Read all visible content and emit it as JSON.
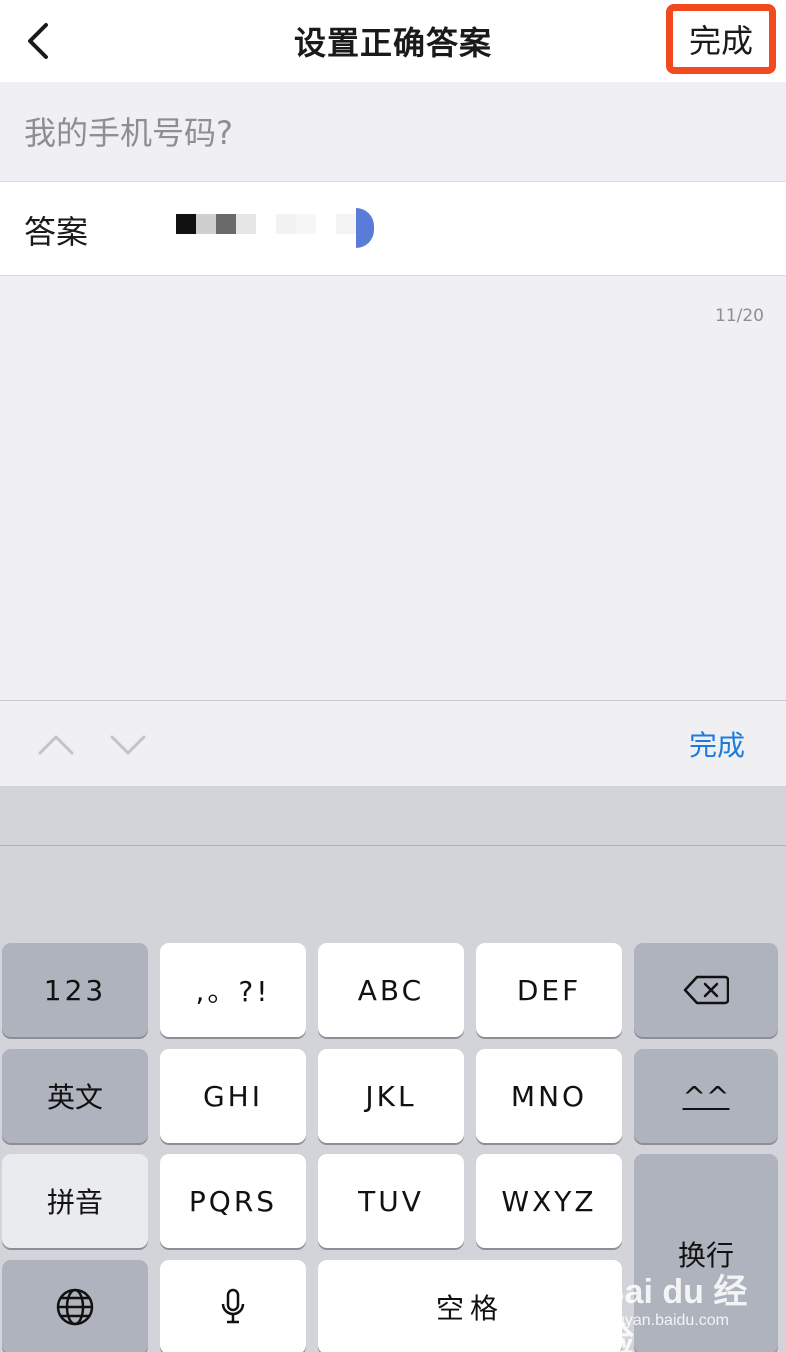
{
  "header": {
    "back_icon": "chevron-left-icon",
    "title": "设置正确答案",
    "done_label": "完成",
    "done_highlight_color": "#f2491f"
  },
  "question": {
    "placeholder": "我的手机号码?"
  },
  "answer": {
    "label": "答案",
    "value_obscured": true,
    "value": ""
  },
  "counter": "11/20",
  "accessory": {
    "prev_icon": "chevron-up-icon",
    "next_icon": "chevron-down-icon",
    "done_label": "完成",
    "accent_color": "#1e7bdc"
  },
  "keyboard": {
    "rows": [
      [
        "123",
        ",。?!",
        "ABC",
        "DEF",
        "delete-icon"
      ],
      [
        "英文",
        "GHI",
        "JKL",
        "MNO",
        "^^"
      ],
      [
        "拼音",
        "PQRS",
        "TUV",
        "WXYZ",
        "换行"
      ],
      [
        "globe-icon",
        "microphone-icon",
        "空格"
      ]
    ],
    "k123": "123",
    "punct": ",。?!",
    "abc": "ABC",
    "def": "DEF",
    "english": "英文",
    "ghi": "GHI",
    "jkl": "JKL",
    "mno": "MNO",
    "emoticon": "^^",
    "pinyin": "拼音",
    "pqrs": "PQRS",
    "tuv": "TUV",
    "wxyz": "WXYZ",
    "return": "换行",
    "space": "空格"
  },
  "watermark": {
    "main": "Bai du 经验",
    "sub": "jingyan.baidu.com"
  }
}
